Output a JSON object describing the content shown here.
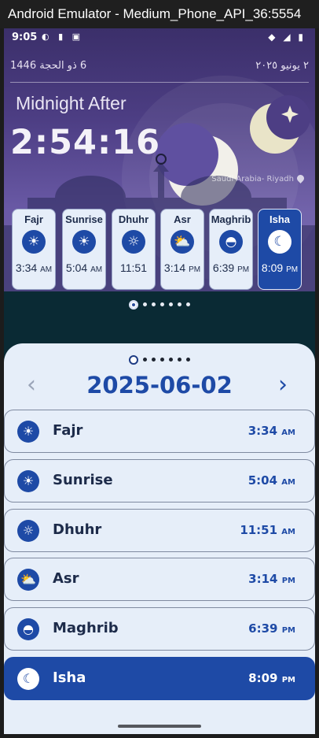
{
  "window": {
    "title": "Android Emulator - Medium_Phone_API_36:5554"
  },
  "status_bar": {
    "time": "9:05"
  },
  "hero": {
    "hijri_date": "6 ذو الحجة 1446",
    "gregorian_date": "٢ يونيو ٢٠٢٥",
    "heading": "Midnight After",
    "countdown": "2:54:16",
    "location": "Saudi Arabia- Riyadh"
  },
  "cards": [
    {
      "name": "Fajr",
      "time": "3:34",
      "ampm": "AM",
      "icon": "sunrise-icon"
    },
    {
      "name": "Sunrise",
      "time": "5:04",
      "ampm": "AM",
      "icon": "sunrise-icon"
    },
    {
      "name": "Dhuhr",
      "time": "11:51",
      "ampm": "",
      "icon": "sun-icon"
    },
    {
      "name": "Asr",
      "time": "3:14",
      "ampm": "PM",
      "icon": "cloud-sun-icon"
    },
    {
      "name": "Maghrib",
      "time": "6:39",
      "ampm": "PM",
      "icon": "sunset-icon"
    },
    {
      "name": "Isha",
      "time": "8:09",
      "ampm": "PM",
      "icon": "moon-icon",
      "active": true
    }
  ],
  "pager": {
    "selected": 0,
    "count": 7
  },
  "sheet": {
    "date": "2025-06-02",
    "rows": [
      {
        "name": "Fajr",
        "time": "3:34",
        "ampm": "AM",
        "icon": "sunrise-icon"
      },
      {
        "name": "Sunrise",
        "time": "5:04",
        "ampm": "AM",
        "icon": "sunrise-icon"
      },
      {
        "name": "Dhuhr",
        "time": "11:51",
        "ampm": "AM",
        "icon": "sun-icon"
      },
      {
        "name": "Asr",
        "time": "3:14",
        "ampm": "PM",
        "icon": "cloud-sun-icon"
      },
      {
        "name": "Maghrib",
        "time": "6:39",
        "ampm": "PM",
        "icon": "sunset-icon"
      },
      {
        "name": "Isha",
        "time": "8:09",
        "ampm": "PM",
        "icon": "moon-icon",
        "active": true
      }
    ]
  },
  "colors": {
    "accent": "#1e4aa6",
    "sheet_bg": "#e6eef9",
    "hero_top": "#3b2f6a"
  }
}
